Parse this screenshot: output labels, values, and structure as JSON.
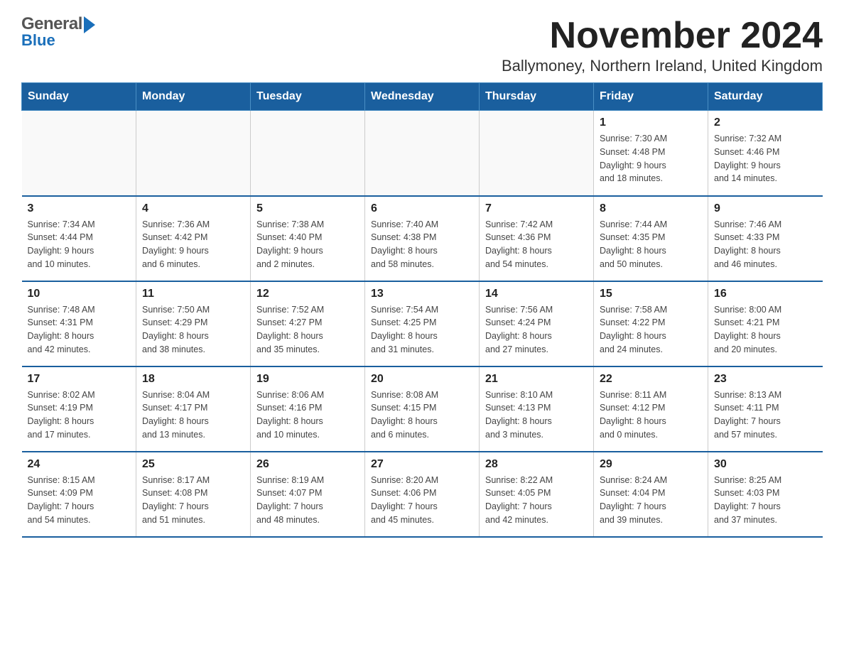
{
  "header": {
    "logo_line1": "General",
    "logo_line2": "Blue",
    "title": "November 2024",
    "subtitle": "Ballymoney, Northern Ireland, United Kingdom"
  },
  "calendar": {
    "days_of_week": [
      "Sunday",
      "Monday",
      "Tuesday",
      "Wednesday",
      "Thursday",
      "Friday",
      "Saturday"
    ],
    "weeks": [
      [
        {
          "day": "",
          "info": ""
        },
        {
          "day": "",
          "info": ""
        },
        {
          "day": "",
          "info": ""
        },
        {
          "day": "",
          "info": ""
        },
        {
          "day": "",
          "info": ""
        },
        {
          "day": "1",
          "info": "Sunrise: 7:30 AM\nSunset: 4:48 PM\nDaylight: 9 hours\nand 18 minutes."
        },
        {
          "day": "2",
          "info": "Sunrise: 7:32 AM\nSunset: 4:46 PM\nDaylight: 9 hours\nand 14 minutes."
        }
      ],
      [
        {
          "day": "3",
          "info": "Sunrise: 7:34 AM\nSunset: 4:44 PM\nDaylight: 9 hours\nand 10 minutes."
        },
        {
          "day": "4",
          "info": "Sunrise: 7:36 AM\nSunset: 4:42 PM\nDaylight: 9 hours\nand 6 minutes."
        },
        {
          "day": "5",
          "info": "Sunrise: 7:38 AM\nSunset: 4:40 PM\nDaylight: 9 hours\nand 2 minutes."
        },
        {
          "day": "6",
          "info": "Sunrise: 7:40 AM\nSunset: 4:38 PM\nDaylight: 8 hours\nand 58 minutes."
        },
        {
          "day": "7",
          "info": "Sunrise: 7:42 AM\nSunset: 4:36 PM\nDaylight: 8 hours\nand 54 minutes."
        },
        {
          "day": "8",
          "info": "Sunrise: 7:44 AM\nSunset: 4:35 PM\nDaylight: 8 hours\nand 50 minutes."
        },
        {
          "day": "9",
          "info": "Sunrise: 7:46 AM\nSunset: 4:33 PM\nDaylight: 8 hours\nand 46 minutes."
        }
      ],
      [
        {
          "day": "10",
          "info": "Sunrise: 7:48 AM\nSunset: 4:31 PM\nDaylight: 8 hours\nand 42 minutes."
        },
        {
          "day": "11",
          "info": "Sunrise: 7:50 AM\nSunset: 4:29 PM\nDaylight: 8 hours\nand 38 minutes."
        },
        {
          "day": "12",
          "info": "Sunrise: 7:52 AM\nSunset: 4:27 PM\nDaylight: 8 hours\nand 35 minutes."
        },
        {
          "day": "13",
          "info": "Sunrise: 7:54 AM\nSunset: 4:25 PM\nDaylight: 8 hours\nand 31 minutes."
        },
        {
          "day": "14",
          "info": "Sunrise: 7:56 AM\nSunset: 4:24 PM\nDaylight: 8 hours\nand 27 minutes."
        },
        {
          "day": "15",
          "info": "Sunrise: 7:58 AM\nSunset: 4:22 PM\nDaylight: 8 hours\nand 24 minutes."
        },
        {
          "day": "16",
          "info": "Sunrise: 8:00 AM\nSunset: 4:21 PM\nDaylight: 8 hours\nand 20 minutes."
        }
      ],
      [
        {
          "day": "17",
          "info": "Sunrise: 8:02 AM\nSunset: 4:19 PM\nDaylight: 8 hours\nand 17 minutes."
        },
        {
          "day": "18",
          "info": "Sunrise: 8:04 AM\nSunset: 4:17 PM\nDaylight: 8 hours\nand 13 minutes."
        },
        {
          "day": "19",
          "info": "Sunrise: 8:06 AM\nSunset: 4:16 PM\nDaylight: 8 hours\nand 10 minutes."
        },
        {
          "day": "20",
          "info": "Sunrise: 8:08 AM\nSunset: 4:15 PM\nDaylight: 8 hours\nand 6 minutes."
        },
        {
          "day": "21",
          "info": "Sunrise: 8:10 AM\nSunset: 4:13 PM\nDaylight: 8 hours\nand 3 minutes."
        },
        {
          "day": "22",
          "info": "Sunrise: 8:11 AM\nSunset: 4:12 PM\nDaylight: 8 hours\nand 0 minutes."
        },
        {
          "day": "23",
          "info": "Sunrise: 8:13 AM\nSunset: 4:11 PM\nDaylight: 7 hours\nand 57 minutes."
        }
      ],
      [
        {
          "day": "24",
          "info": "Sunrise: 8:15 AM\nSunset: 4:09 PM\nDaylight: 7 hours\nand 54 minutes."
        },
        {
          "day": "25",
          "info": "Sunrise: 8:17 AM\nSunset: 4:08 PM\nDaylight: 7 hours\nand 51 minutes."
        },
        {
          "day": "26",
          "info": "Sunrise: 8:19 AM\nSunset: 4:07 PM\nDaylight: 7 hours\nand 48 minutes."
        },
        {
          "day": "27",
          "info": "Sunrise: 8:20 AM\nSunset: 4:06 PM\nDaylight: 7 hours\nand 45 minutes."
        },
        {
          "day": "28",
          "info": "Sunrise: 8:22 AM\nSunset: 4:05 PM\nDaylight: 7 hours\nand 42 minutes."
        },
        {
          "day": "29",
          "info": "Sunrise: 8:24 AM\nSunset: 4:04 PM\nDaylight: 7 hours\nand 39 minutes."
        },
        {
          "day": "30",
          "info": "Sunrise: 8:25 AM\nSunset: 4:03 PM\nDaylight: 7 hours\nand 37 minutes."
        }
      ]
    ]
  }
}
